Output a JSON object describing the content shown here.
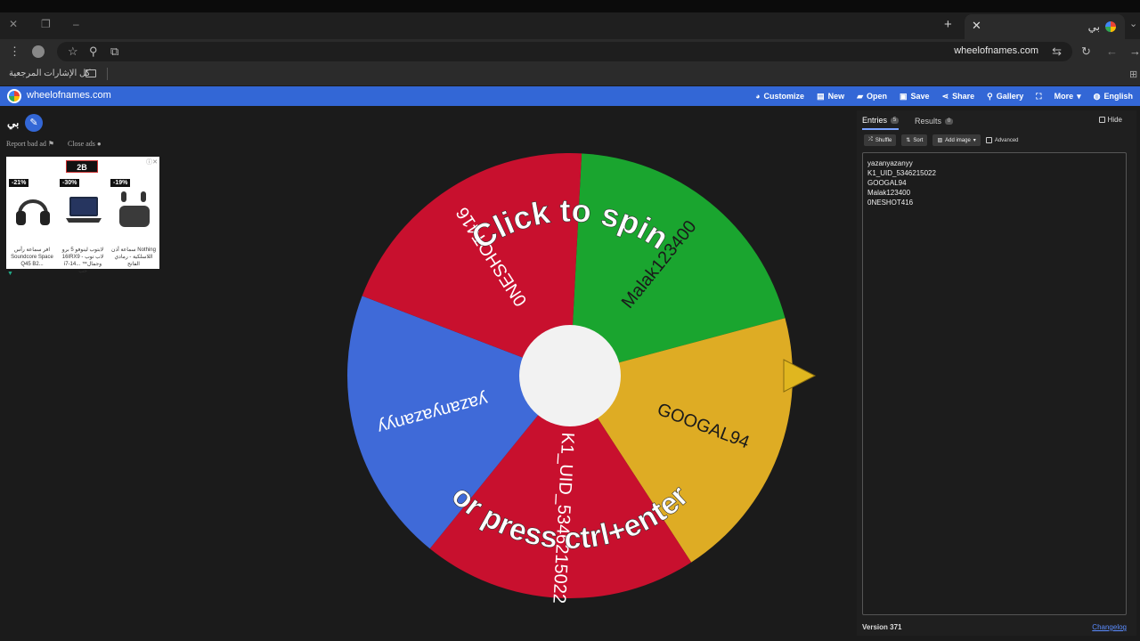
{
  "browser": {
    "tab_title": "بي",
    "url": "wheelofnames.com",
    "bookmarks_label": "كل الإشارات المرجعية"
  },
  "app": {
    "site_name": "wheelofnames.com",
    "menu": [
      {
        "label": "Customize",
        "icon": "palette-icon"
      },
      {
        "label": "New",
        "icon": "file-icon"
      },
      {
        "label": "Open",
        "icon": "folder-icon"
      },
      {
        "label": "Save",
        "icon": "save-icon"
      },
      {
        "label": "Share",
        "icon": "share-icon"
      },
      {
        "label": "Gallery",
        "icon": "search-icon"
      },
      {
        "label": "",
        "icon": "fullscreen-icon"
      },
      {
        "label": "More",
        "icon": "chevron-down-icon"
      },
      {
        "label": "English",
        "icon": "globe-icon"
      }
    ]
  },
  "left": {
    "wheel_title": "بي",
    "report_ad": "Report bad ad",
    "close_ads": "Close ads",
    "ad": {
      "products": [
        {
          "badge": "-21%",
          "caption": "افر سماعة رأس Soundcore Space Q45 B2..."
        },
        {
          "badge": "-30%",
          "caption": "لابتوب لينوفو 5 برو 16IRX9 - لاب توب i7-14... ™وجمال حب"
        },
        {
          "badge": "-19%",
          "caption": "سماعة أذن Nothing اللاسلكية - رمادي الفاتح"
        }
      ]
    }
  },
  "wheel": {
    "spin_text_top": "Click to spin",
    "spin_text_bottom": "or press ctrl+enter",
    "segments": [
      {
        "label": "Malak123400",
        "color": "#1aa52f"
      },
      {
        "label": "GOOGAL94",
        "color": "#deac24"
      },
      {
        "label": "K1_UID_5346215022",
        "color": "#c8102e"
      },
      {
        "label": "yazanyazanyy",
        "color": "#3f6ad8"
      },
      {
        "label": "0NESHOT416",
        "color": "#c8102e"
      }
    ]
  },
  "right": {
    "tabs": [
      {
        "label": "Entries",
        "count": "5"
      },
      {
        "label": "Results",
        "count": "0"
      }
    ],
    "hide_label": "Hide",
    "tools": {
      "shuffle": "Shuffle",
      "sort": "Sort",
      "add_image": "Add image",
      "advanced": "Advanced"
    },
    "entries": [
      "yazanyazanyy",
      "K1_UID_5346215022",
      "GOOGAL94",
      "Malak123400",
      "0NESHOT416"
    ],
    "version": "Version 371",
    "changelog": "Changelog"
  }
}
